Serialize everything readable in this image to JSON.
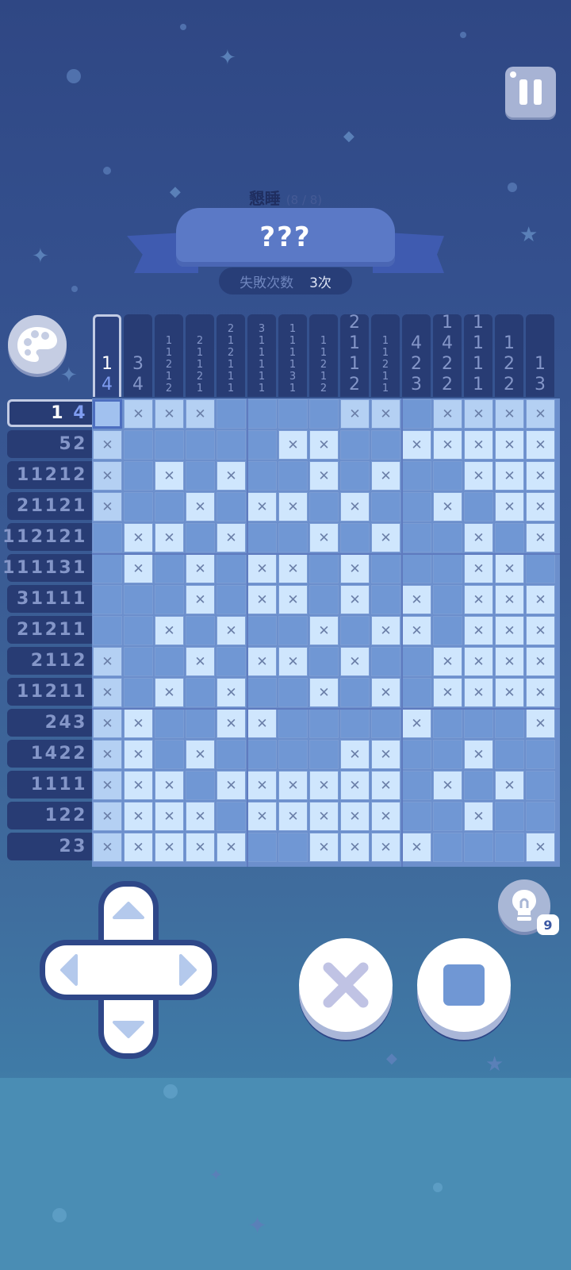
{
  "header": {
    "level_name": "懇睡",
    "level_progress": "(8 / 8)",
    "puzzle_title": "???",
    "fail_label": "失敗次数",
    "fail_count": "3次"
  },
  "hint": {
    "count": "9"
  },
  "selection": {
    "row": 0,
    "col": 0
  },
  "column_clues": [
    [
      "1",
      "4"
    ],
    [
      "3",
      "4"
    ],
    [
      "1",
      "1",
      "2",
      "1",
      "2"
    ],
    [
      "2",
      "1",
      "1",
      "2",
      "1"
    ],
    [
      "2",
      "1",
      "2",
      "1",
      "1",
      "1"
    ],
    [
      "3",
      "1",
      "1",
      "1",
      "1",
      "1"
    ],
    [
      "1",
      "1",
      "1",
      "1",
      "3",
      "1"
    ],
    [
      "1",
      "1",
      "2",
      "1",
      "2"
    ],
    [
      "2",
      "1",
      "1",
      "2"
    ],
    [
      "1",
      "1",
      "2",
      "1",
      "1"
    ],
    [
      "4",
      "2",
      "3"
    ],
    [
      "1",
      "4",
      "2",
      "2"
    ],
    [
      "1",
      "1",
      "1",
      "1"
    ],
    [
      "1",
      "2",
      "2"
    ],
    [
      "1",
      "3"
    ]
  ],
  "row_clues": [
    {
      "left": "1",
      "last": "4"
    },
    {
      "left": "",
      "last": "52"
    },
    {
      "left": "",
      "last": "11212"
    },
    {
      "left": "",
      "last": "21121"
    },
    {
      "left": "",
      "last": "112121"
    },
    {
      "left": "",
      "last": "111131"
    },
    {
      "left": "",
      "last": "31111"
    },
    {
      "left": "",
      "last": "21211"
    },
    {
      "left": "",
      "last": "2112"
    },
    {
      "left": "",
      "last": "11211"
    },
    {
      "left": "",
      "last": "243"
    },
    {
      "left": "",
      "last": "1422"
    },
    {
      "left": "",
      "last": "1111"
    },
    {
      "left": "",
      "last": "122"
    },
    {
      "left": "",
      "last": "23"
    }
  ],
  "grid": [
    "_xxx____xx_xxxx",
    "x_____xx__xxxxx",
    "x_x_x__x_x__xxx",
    "x__x_xx_x__x_xx",
    "_xx_x__x_x__x_x",
    "_x_x_xx_x___xx_",
    "___x_xx_x_x_xxx",
    "__x_x__x_xx_xxx",
    "x__x_xx_x__xxxx",
    "x_x_x__x_x_xxxx",
    "xx__xx____x___x",
    "xx_x____xx__x__",
    "xxx_xxxxxx_x_x_",
    "xxxx_xxxxx__x__",
    "xxxxx__xxxx___x"
  ],
  "icons": {
    "pause": "pause-icon",
    "palette": "palette-icon",
    "hint": "lightbulb-icon",
    "cross_tool": "x-mark-icon",
    "fill_tool": "square-fill-icon"
  },
  "colors": {
    "filled_cell": "#7097d4",
    "empty_cell": "#cfe6fd",
    "clue_bg": "#283c74",
    "accent": "#5b79c6"
  }
}
